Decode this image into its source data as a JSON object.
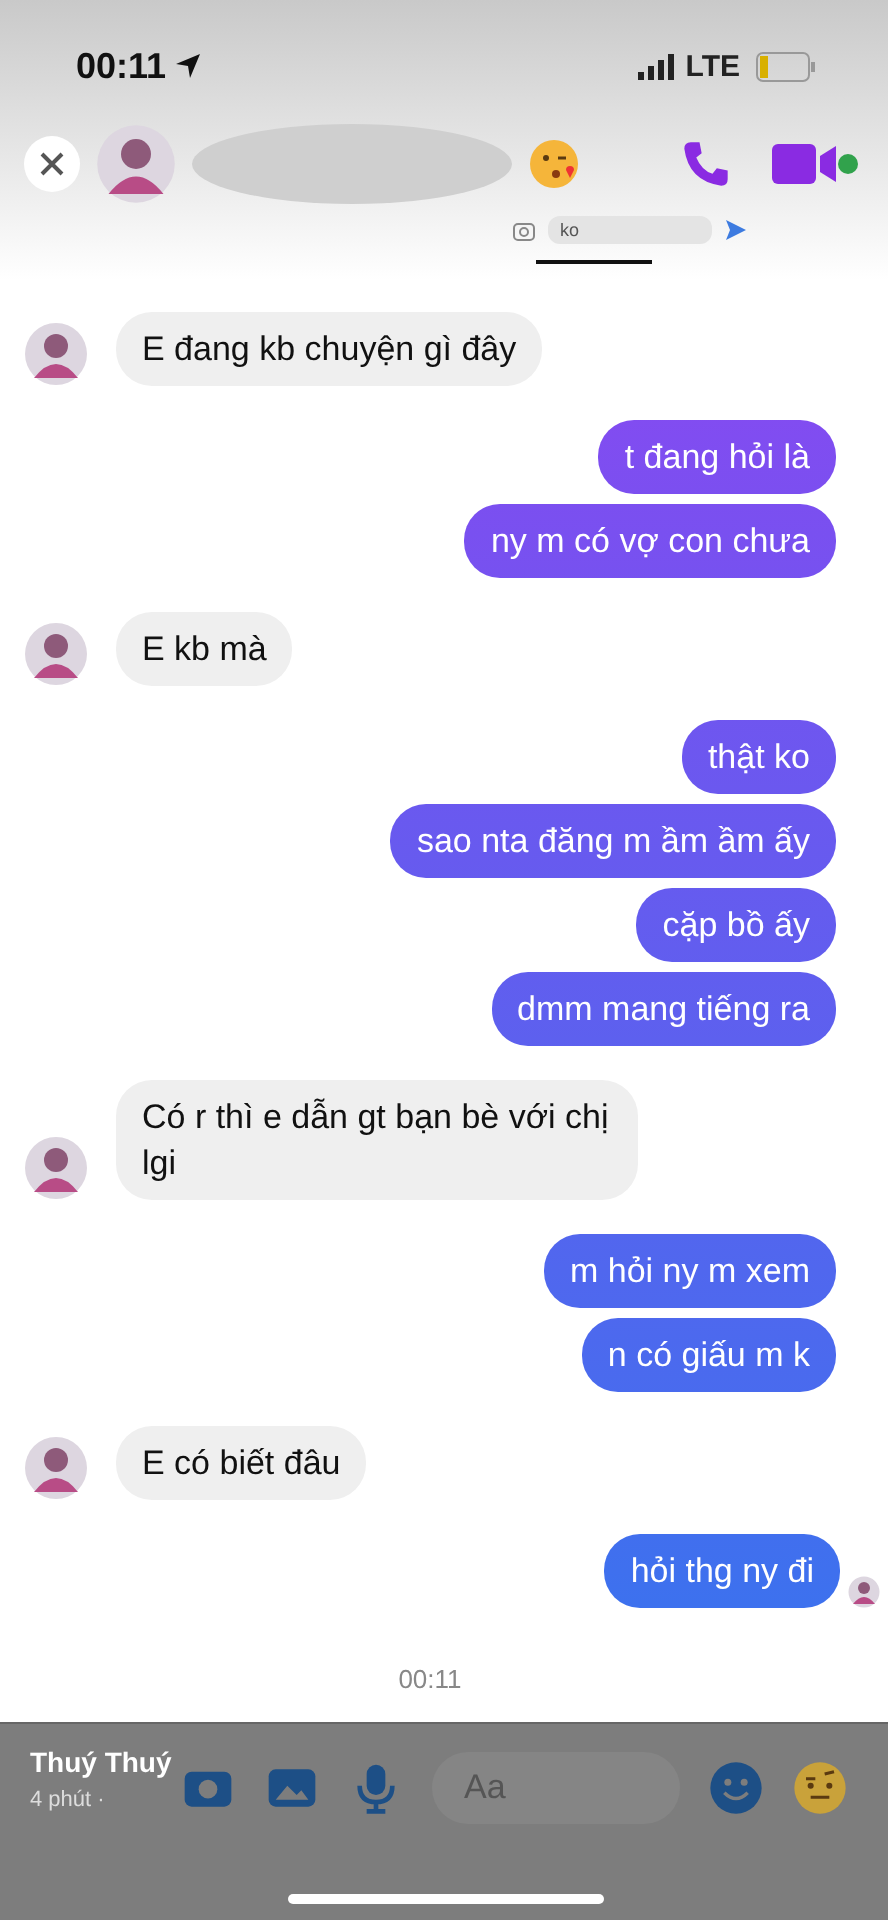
{
  "status_bar": {
    "time": "00:11",
    "network": "LTE"
  },
  "header": {
    "mini_composer": {
      "value": "ko"
    }
  },
  "messages": [
    {
      "kind": "incoming",
      "text": "E đang kb chuyện gì đây",
      "avatar": true
    },
    {
      "kind": "outgoing",
      "text": "t đang hỏi là"
    },
    {
      "kind": "outgoing",
      "text": "ny m có vợ con chưa"
    },
    {
      "kind": "incoming",
      "text": "E kb mà",
      "avatar": true
    },
    {
      "kind": "outgoing",
      "text": "thật ko"
    },
    {
      "kind": "outgoing",
      "text": "sao nta đăng m ầm ầm ấy"
    },
    {
      "kind": "outgoing",
      "text": "cặp bồ ấy"
    },
    {
      "kind": "outgoing",
      "text": "dmm mang tiếng ra"
    },
    {
      "kind": "incoming",
      "text": "Có r thì e dẫn gt bạn bè với chị lgi",
      "avatar": true
    },
    {
      "kind": "outgoing",
      "text": "m hỏi ny m xem"
    },
    {
      "kind": "outgoing",
      "text": "n có giấu m k"
    },
    {
      "kind": "incoming",
      "text": "E có biết đâu",
      "avatar": true
    },
    {
      "kind": "outgoing",
      "text": "hỏi thg ny đi",
      "read": true
    }
  ],
  "timestamp": "00:11",
  "overlay": {
    "name": "Thuý Thuý",
    "meta": "4 phút ·"
  },
  "composer": {
    "placeholder": "Aa"
  }
}
